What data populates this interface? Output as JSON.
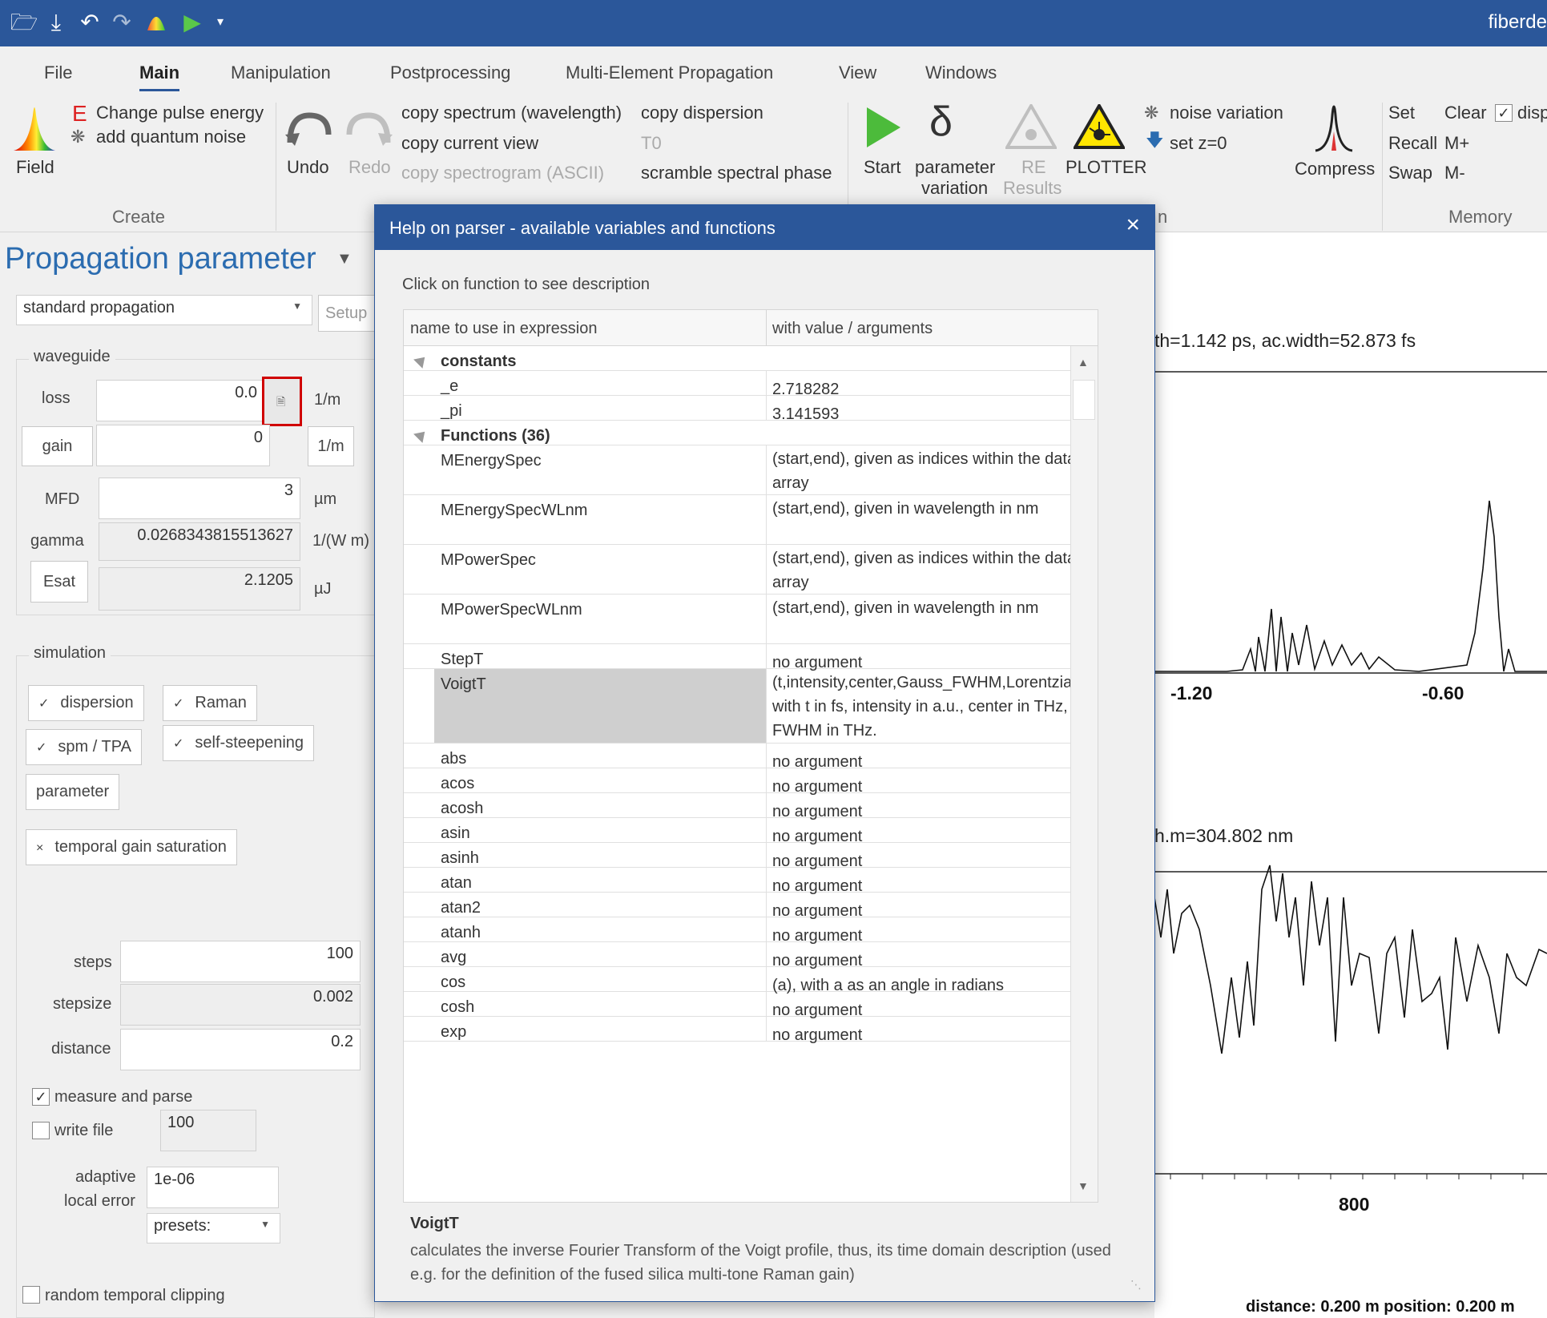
{
  "app": {
    "title": "fiberde"
  },
  "ribbon": {
    "tabs": [
      "File",
      "Main",
      "Manipulation",
      "Postprocessing",
      "Multi-Element Propagation",
      "View",
      "Windows"
    ],
    "field_label": "Field",
    "change_pulse_energy": "Change pulse energy",
    "add_quantum_noise": "add quantum noise",
    "create_group": "Create",
    "undo": "Undo",
    "redo": "Redo",
    "copy_spectrum": "copy spectrum (wavelength)",
    "copy_current_view": "copy current view",
    "copy_spectrogram": "copy spectrogram (ASCII)",
    "copy_dispersion": "copy dispersion",
    "t0": "T0",
    "scramble": "scramble spectral phase",
    "start": "Start",
    "param_var1": "parameter",
    "param_var2": "variation",
    "re1": "RE",
    "re2": "Results",
    "plotter": "PLOTTER",
    "noise_variation": "noise variation",
    "set_z0": "set z=0",
    "compress": "Compress",
    "n_frag": "n",
    "mem_set": "Set",
    "mem_recall": "Recall",
    "mem_swap": "Swap",
    "mem_clear": "Clear",
    "mem_mplus": "M+",
    "mem_mminus": "M-",
    "disp": "disp",
    "memory_group": "Memory"
  },
  "left": {
    "title": "Propagation parameter",
    "mode": "standard propagation",
    "setup": "Setup",
    "waveguide_legend": "waveguide",
    "loss_label": "loss",
    "loss_value": "0.0",
    "loss_unit": "1/m",
    "gain_label": "gain",
    "gain_value": "0",
    "gain_unit": "1/m",
    "mfd_label": "MFD",
    "mfd_value": "3",
    "mfd_unit": "µm",
    "gamma_label": "gamma",
    "gamma_value": "0.0268343815513627",
    "gamma_unit": "1/(W m)",
    "esat_label": "Esat",
    "esat_value": "2.1205",
    "esat_unit": "µJ",
    "simulation_legend": "simulation",
    "dispersion": "dispersion",
    "raman": "Raman",
    "spm": "spm / TPA",
    "self_steepening": "self-steepening",
    "parameter": "parameter",
    "temporal_gain": "temporal gain saturation",
    "steps_label": "steps",
    "steps_value": "100",
    "stepsize_label": "stepsize",
    "stepsize_value": "0.002",
    "distance_label": "distance",
    "distance_value": "0.2",
    "measure_parse": "measure and parse",
    "write_file": "write file",
    "write_file_value": "100",
    "adaptive1": "adaptive",
    "adaptive2": "local error",
    "adaptive_value": "1e-06",
    "presets": "presets:",
    "random_clip": "random temporal clipping"
  },
  "plot": {
    "top_info": "th=1.142 ps,  ac.width=52.873 fs",
    "top_ticks": [
      "-1.20",
      "-0.60"
    ],
    "bottom_info": "h.m=304.802 nm",
    "bottom_ticks": [
      "800"
    ],
    "status": "distance: 0.200  m   position: 0.200  m"
  },
  "dialog": {
    "title": "Help on parser - available variables and functions",
    "close": "×",
    "subtitle": "Click on function to see description",
    "col1": "name to use in expression",
    "col2": "with value / arguments",
    "rows": [
      {
        "name": "constants",
        "value": "",
        "group": true
      },
      {
        "name": "_e",
        "value": "2.718282"
      },
      {
        "name": "_pi",
        "value": "3.141593"
      },
      {
        "name": "Functions (36)",
        "value": "",
        "group": true
      },
      {
        "name": "MEnergySpec",
        "value": "(start,end), given as indices within the data array",
        "h": 2
      },
      {
        "name": "MEnergySpecWLnm",
        "value": "(start,end), given in wavelength in nm",
        "h": 2
      },
      {
        "name": "MPowerSpec",
        "value": "(start,end), given as indices within the data array",
        "h": 2
      },
      {
        "name": "MPowerSpecWLnm",
        "value": "(start,end), given in wavelength in nm",
        "h": 2
      },
      {
        "name": "StepT",
        "value": "no argument"
      },
      {
        "name": "VoigtT",
        "value": "(t,intensity,center,Gauss_FWHM,Lorentzian_ with t in fs, intensity in a.u., center in THz, FWHM in THz.",
        "h": 3,
        "selected": true
      },
      {
        "name": "abs",
        "value": "no argument"
      },
      {
        "name": "acos",
        "value": "no argument"
      },
      {
        "name": "acosh",
        "value": "no argument"
      },
      {
        "name": "asin",
        "value": "no argument"
      },
      {
        "name": "asinh",
        "value": "no argument"
      },
      {
        "name": "atan",
        "value": "no argument"
      },
      {
        "name": "atan2",
        "value": "no argument"
      },
      {
        "name": "atanh",
        "value": "no argument"
      },
      {
        "name": "avg",
        "value": "no argument"
      },
      {
        "name": "cos",
        "value": "(a), with a as an angle in radians"
      },
      {
        "name": "cosh",
        "value": "no argument"
      },
      {
        "name": "exp",
        "value": "no argument"
      }
    ],
    "desc_name": "VoigtT",
    "desc_text": "calculates the inverse Fourier Transform of the Voigt profile, thus, its time domain description (used e.g. for the definition of the fused silica multi-tone Raman gain)"
  },
  "colors": {
    "accent": "#2b579a",
    "highlight": "#d00000"
  }
}
